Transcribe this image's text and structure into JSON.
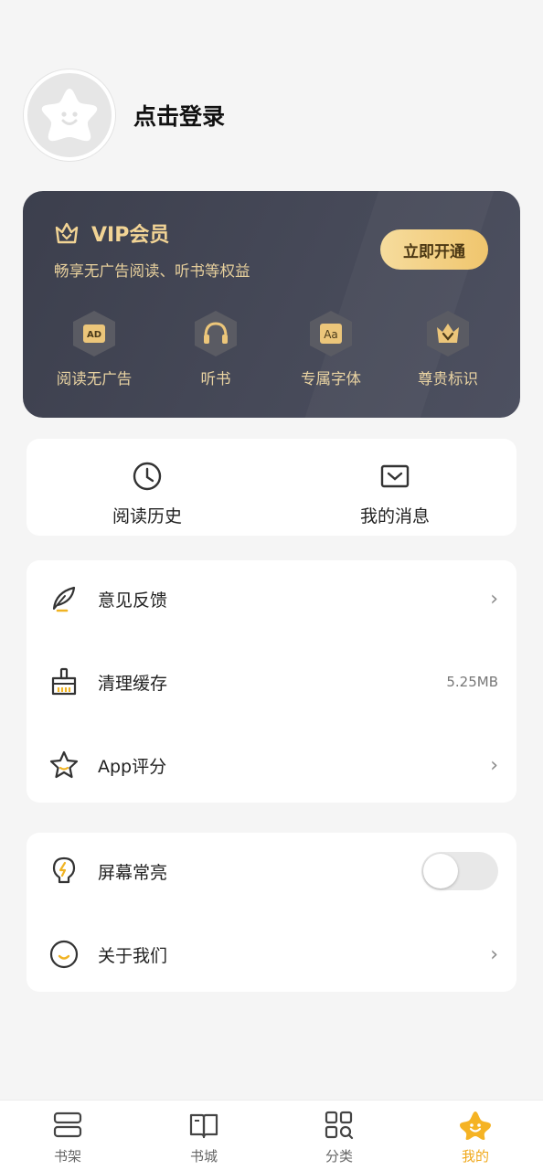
{
  "profile": {
    "login_label": "点击登录"
  },
  "vip": {
    "title": "VIP会员",
    "subtitle": "畅享无广告阅读、听书等权益",
    "cta": "立即开通",
    "perks": [
      {
        "label": "阅读无广告",
        "icon": "ad-icon"
      },
      {
        "label": "听书",
        "icon": "headphones-icon"
      },
      {
        "label": "专属字体",
        "icon": "font-icon"
      },
      {
        "label": "尊贵标识",
        "icon": "crown-badge-icon"
      }
    ]
  },
  "quick": [
    {
      "label": "阅读历史",
      "icon": "clock-icon"
    },
    {
      "label": "我的消息",
      "icon": "message-icon"
    }
  ],
  "menu1": [
    {
      "label": "意见反馈",
      "icon": "feather-icon"
    },
    {
      "label": "清理缓存",
      "icon": "broom-icon",
      "value": "5.25MB"
    },
    {
      "label": "App评分",
      "icon": "star-icon"
    }
  ],
  "menu2": [
    {
      "label": "屏幕常亮",
      "icon": "bulb-icon",
      "toggle": false
    },
    {
      "label": "关于我们",
      "icon": "smile-icon"
    }
  ],
  "tabs": [
    {
      "label": "书架",
      "icon": "bookshelf-icon"
    },
    {
      "label": "书城",
      "icon": "book-open-icon"
    },
    {
      "label": "分类",
      "icon": "category-grid-icon"
    },
    {
      "label": "我的",
      "icon": "mine-star-icon",
      "active": true
    }
  ],
  "colors": {
    "accent": "#f0a81a",
    "vip_gold": "#f2d495",
    "vip_bg": "#3f4250",
    "page_bg": "#f5f5f5"
  }
}
